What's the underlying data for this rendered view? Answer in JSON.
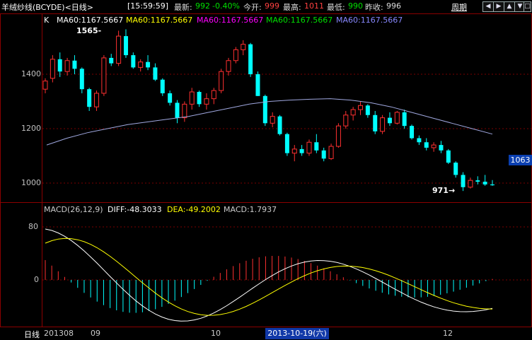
{
  "header": {
    "title": "羊绒纱线(BCYDE)<日线>",
    "time": "[15:59:59]",
    "latest_label": "最新:",
    "latest_value": "992",
    "change": "-0.40%",
    "open_label": "今开:",
    "open_value": "999",
    "high_label": "最高:",
    "high_value": "1011",
    "low_label": "最低:",
    "low_value": "990",
    "prev_label": "昨收:",
    "prev_value": "996",
    "cycle_button": "周期",
    "nav_icons": [
      "arrow-left-icon",
      "arrow-right-icon",
      "arrow-up-icon",
      "arrow-down-icon",
      "square-icon"
    ]
  },
  "price_panel": {
    "k_label": "K",
    "ma_legends": [
      {
        "text": "MA60:1167.5667",
        "color": "#ffffff"
      },
      {
        "text": "MA60:1167.5667",
        "color": "#ffff00"
      },
      {
        "text": "MA60:1167.5667",
        "color": "#ff00ff"
      },
      {
        "text": "MA60:1167.5667",
        "color": "#00e000"
      },
      {
        "text": "MA60:1167.5667",
        "color": "#8888ff"
      }
    ],
    "y_ticks": [
      "1400",
      "1200",
      "1000"
    ],
    "high_marker": "1565",
    "low_marker": "971",
    "current_price_tag": "1063"
  },
  "macd_panel": {
    "title": "MACD(26,12,9)",
    "diff": "DIFF:-48.3033",
    "dea": "DEA:-49.2002",
    "macd": "MACD:1.7937",
    "y_ticks": [
      "80",
      "0"
    ]
  },
  "x_axis": {
    "period_label": "日线",
    "labels": [
      "201308",
      "09",
      "10",
      "12"
    ],
    "selected_date": "2013-10-19(六)"
  },
  "colors": {
    "up": "#ff3030",
    "down": "#00ffff",
    "ma": "#a0a8e0",
    "diff": "#ffffff",
    "dea": "#ffff00",
    "grid": "#8b0000"
  },
  "chart_data": {
    "type": "candlestick",
    "ohlc": [
      [
        1345,
        1385,
        1330,
        1375
      ],
      [
        1385,
        1470,
        1370,
        1455
      ],
      [
        1455,
        1480,
        1390,
        1410
      ],
      [
        1410,
        1460,
        1395,
        1450
      ],
      [
        1450,
        1470,
        1400,
        1420
      ],
      [
        1420,
        1425,
        1330,
        1345
      ],
      [
        1345,
        1350,
        1265,
        1280
      ],
      [
        1280,
        1340,
        1265,
        1330
      ],
      [
        1330,
        1470,
        1320,
        1460
      ],
      [
        1460,
        1475,
        1430,
        1440
      ],
      [
        1440,
        1560,
        1430,
        1540
      ],
      [
        1540,
        1565,
        1460,
        1470
      ],
      [
        1470,
        1480,
        1420,
        1425
      ],
      [
        1425,
        1455,
        1410,
        1445
      ],
      [
        1445,
        1470,
        1415,
        1425
      ],
      [
        1425,
        1440,
        1375,
        1380
      ],
      [
        1380,
        1385,
        1320,
        1330
      ],
      [
        1330,
        1340,
        1285,
        1295
      ],
      [
        1295,
        1305,
        1220,
        1240
      ],
      [
        1240,
        1300,
        1225,
        1290
      ],
      [
        1290,
        1350,
        1270,
        1335
      ],
      [
        1335,
        1340,
        1280,
        1290
      ],
      [
        1290,
        1330,
        1270,
        1310
      ],
      [
        1310,
        1350,
        1290,
        1340
      ],
      [
        1340,
        1420,
        1330,
        1410
      ],
      [
        1410,
        1460,
        1395,
        1450
      ],
      [
        1450,
        1500,
        1440,
        1490
      ],
      [
        1490,
        1525,
        1470,
        1510
      ],
      [
        1510,
        1515,
        1390,
        1400
      ],
      [
        1400,
        1410,
        1320,
        1320
      ],
      [
        1320,
        1325,
        1210,
        1220
      ],
      [
        1220,
        1260,
        1205,
        1245
      ],
      [
        1245,
        1250,
        1175,
        1180
      ],
      [
        1180,
        1185,
        1100,
        1110
      ],
      [
        1110,
        1140,
        1080,
        1125
      ],
      [
        1125,
        1140,
        1100,
        1110
      ],
      [
        1110,
        1160,
        1100,
        1150
      ],
      [
        1150,
        1180,
        1110,
        1120
      ],
      [
        1120,
        1130,
        1080,
        1090
      ],
      [
        1090,
        1145,
        1085,
        1135
      ],
      [
        1135,
        1220,
        1130,
        1210
      ],
      [
        1210,
        1265,
        1200,
        1250
      ],
      [
        1250,
        1280,
        1230,
        1270
      ],
      [
        1270,
        1300,
        1250,
        1285
      ],
      [
        1285,
        1290,
        1240,
        1250
      ],
      [
        1250,
        1265,
        1180,
        1190
      ],
      [
        1190,
        1250,
        1180,
        1240
      ],
      [
        1240,
        1260,
        1210,
        1220
      ],
      [
        1220,
        1265,
        1215,
        1260
      ],
      [
        1260,
        1270,
        1200,
        1210
      ],
      [
        1210,
        1215,
        1160,
        1165
      ],
      [
        1165,
        1175,
        1140,
        1150
      ],
      [
        1150,
        1165,
        1120,
        1130
      ],
      [
        1130,
        1150,
        1115,
        1140
      ],
      [
        1140,
        1155,
        1110,
        1120
      ],
      [
        1120,
        1125,
        1070,
        1075
      ],
      [
        1075,
        1080,
        1020,
        1030
      ],
      [
        1030,
        1040,
        971,
        985
      ],
      [
        985,
        1020,
        980,
        1010
      ],
      [
        1010,
        1025,
        995,
        1005
      ],
      [
        1005,
        1030,
        990,
        995
      ],
      [
        995,
        1011,
        990,
        992
      ]
    ],
    "ma60_points": [
      1140,
      1165,
      1185,
      1200,
      1215,
      1225,
      1235,
      1245,
      1260,
      1275,
      1290,
      1300,
      1305,
      1308,
      1310,
      1305,
      1295,
      1280,
      1260,
      1240,
      1220,
      1200,
      1180
    ]
  }
}
